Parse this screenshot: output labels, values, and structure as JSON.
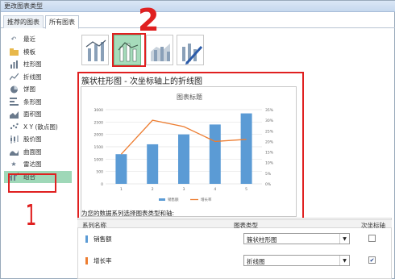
{
  "window": {
    "title": "更改图表类型"
  },
  "tabs": [
    {
      "label": "推荐的图表"
    },
    {
      "label": "所有图表"
    }
  ],
  "sidebar": {
    "items": [
      {
        "label": "最近",
        "icon": "recent-icon"
      },
      {
        "label": "模板",
        "icon": "folder-icon"
      },
      {
        "label": "柱形图",
        "icon": "column-chart-icon"
      },
      {
        "label": "折线图",
        "icon": "line-chart-icon"
      },
      {
        "label": "饼图",
        "icon": "pie-chart-icon"
      },
      {
        "label": "条形图",
        "icon": "bar-chart-icon"
      },
      {
        "label": "面积图",
        "icon": "area-chart-icon"
      },
      {
        "label": "X Y (散点图)",
        "icon": "scatter-chart-icon"
      },
      {
        "label": "股价图",
        "icon": "stock-chart-icon"
      },
      {
        "label": "曲面图",
        "icon": "surface-chart-icon"
      },
      {
        "label": "雷达图",
        "icon": "radar-chart-icon"
      },
      {
        "label": "组合",
        "icon": "combo-chart-icon"
      }
    ],
    "selected": "组合"
  },
  "annotations": {
    "step1": "1",
    "step2": "2",
    "color": "#e02020"
  },
  "main": {
    "section_title": "簇状柱形图 - 次坐标轴上的折线图",
    "preview": {
      "title": "图表标题",
      "legend": [
        "销售额",
        "增长率"
      ]
    },
    "instruction": "为您的数据系列选择图表类型和轴:",
    "table": {
      "headers": {
        "name": "系列名称",
        "type": "图表类型",
        "secondary": "次坐标轴"
      },
      "rows": [
        {
          "name": "销售额",
          "color": "#5b9bd5",
          "type": "簇状柱形图",
          "secondary": false
        },
        {
          "name": "增长率",
          "color": "#ed7d31",
          "type": "折线图",
          "secondary": true
        }
      ]
    }
  },
  "chart_data": {
    "type": "bar",
    "title": "图表标题",
    "categories": [
      "1",
      "2",
      "3",
      "4",
      "5"
    ],
    "series": [
      {
        "name": "销售额",
        "type": "bar",
        "axis": "primary",
        "color": "#5b9bd5",
        "values": [
          1200,
          1600,
          2000,
          2400,
          2850
        ]
      },
      {
        "name": "增长率",
        "type": "line",
        "axis": "secondary",
        "color": "#ed7d31",
        "values": [
          0.14,
          0.3,
          0.27,
          0.2,
          0.21
        ]
      }
    ],
    "ylim": [
      0,
      3000
    ],
    "y_ticks": [
      "0",
      "500",
      "1000",
      "1500",
      "2000",
      "2500",
      "3000"
    ],
    "y2lim": [
      0,
      0.35
    ],
    "y2_ticks": [
      "0%",
      "5%",
      "10%",
      "15%",
      "20%",
      "25%",
      "30%",
      "35%"
    ],
    "grid": true,
    "legend": "bottom"
  }
}
